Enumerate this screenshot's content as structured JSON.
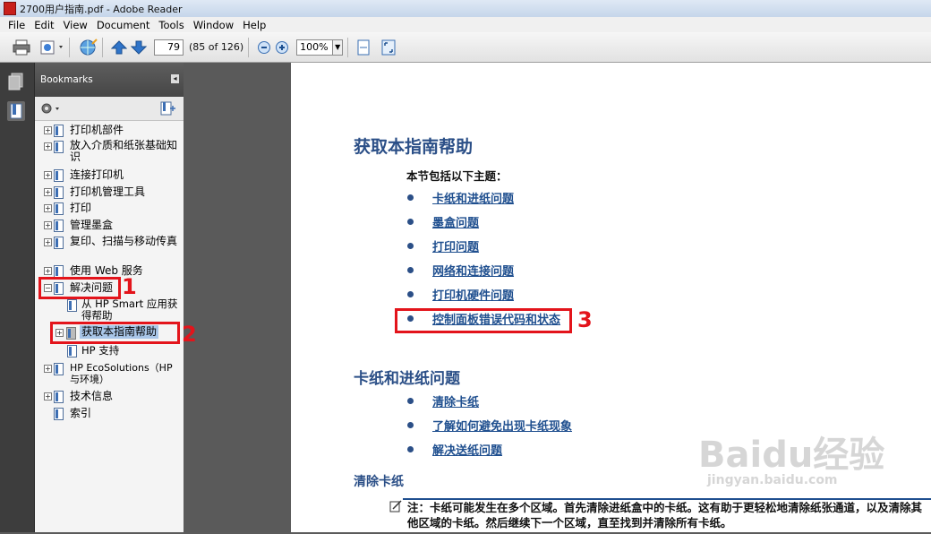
{
  "window": {
    "title": "2700用户指南.pdf - Adobe Reader"
  },
  "menu": [
    "File",
    "Edit",
    "View",
    "Document",
    "Tools",
    "Window",
    "Help"
  ],
  "toolbar": {
    "page_current": "79",
    "page_total": "(85 of 126)",
    "zoom": "100%"
  },
  "sidebar": {
    "title": "Bookmarks",
    "items": [
      {
        "label": "打印机部件"
      },
      {
        "label": "放入介质和纸张基础知识"
      },
      {
        "label": "连接打印机"
      },
      {
        "label": "打印机管理工具"
      },
      {
        "label": "打印"
      },
      {
        "label": "管理墨盒"
      },
      {
        "label": "复印、扫描与移动传真"
      },
      {
        "label": "使用 Web 服务"
      },
      {
        "label": "解决问题"
      },
      {
        "label": "从 HP Smart 应用获得帮助"
      },
      {
        "label": "获取本指南帮助"
      },
      {
        "label": "HP 支持"
      },
      {
        "label": "HP EcoSolutions（HP 与环境）"
      },
      {
        "label": "技术信息"
      },
      {
        "label": "索引"
      }
    ]
  },
  "document": {
    "heading": "获取本指南帮助",
    "intro": "本节包括以下主题：",
    "links": [
      "卡纸和进纸问题",
      "墨盒问题",
      "打印问题",
      "网络和连接问题",
      "打印机硬件问题",
      "控制面板错误代码和状态"
    ],
    "section2_heading": "卡纸和进纸问题",
    "section2_links": [
      "清除卡纸",
      "了解如何避免出现卡纸现象",
      "解决送纸问题"
    ],
    "section3_heading": "清除卡纸",
    "note_text": "注：卡纸可能发生在多个区域。首先清除进纸盒中的卡纸。这有助于更轻松地清除纸张通道，以及清除其他区域的卡纸。然后继续下一个区域，直至找到并清除所有卡纸。"
  },
  "annotations": {
    "n1": "1",
    "n2": "2",
    "n3": "3",
    "accent": "#e3141b"
  },
  "watermark": {
    "brand": "Baidu经验",
    "url": "jingyan.baidu.com"
  }
}
